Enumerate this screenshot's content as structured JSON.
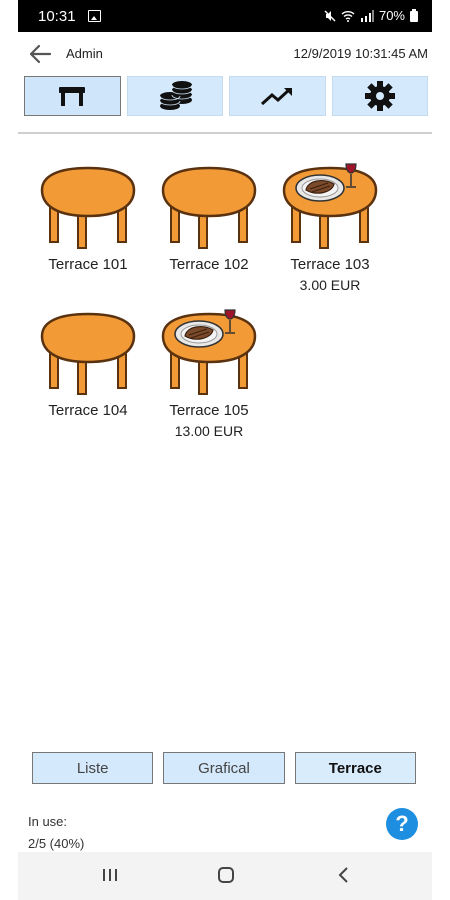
{
  "status": {
    "time": "10:31",
    "battery": "70%"
  },
  "header": {
    "user": "Admin",
    "datetime": "12/9/2019 10:31:45 AM"
  },
  "toolbar": [
    "table-icon",
    "coins-icon",
    "chart-trend-icon",
    "gear-icon"
  ],
  "tables": [
    {
      "name": "Terrace 101",
      "amount": "",
      "occupied": false
    },
    {
      "name": "Terrace 102",
      "amount": "",
      "occupied": false
    },
    {
      "name": "Terrace 103",
      "amount": "3.00 EUR",
      "occupied": true
    },
    {
      "name": "Terrace 104",
      "amount": "",
      "occupied": false
    },
    {
      "name": "Terrace 105",
      "amount": "13.00 EUR",
      "occupied": true
    }
  ],
  "views": {
    "list": "Liste",
    "graphical": "Grafical",
    "area": "Terrace"
  },
  "usage": {
    "label": "In use:",
    "value": "2/5 (40%)"
  },
  "help": {
    "label": "?"
  },
  "colors": {
    "accent": "#1e8ee0",
    "button_bg": "#d4e9fb",
    "table_top": "#f29a36",
    "table_edge": "#5a3210"
  }
}
